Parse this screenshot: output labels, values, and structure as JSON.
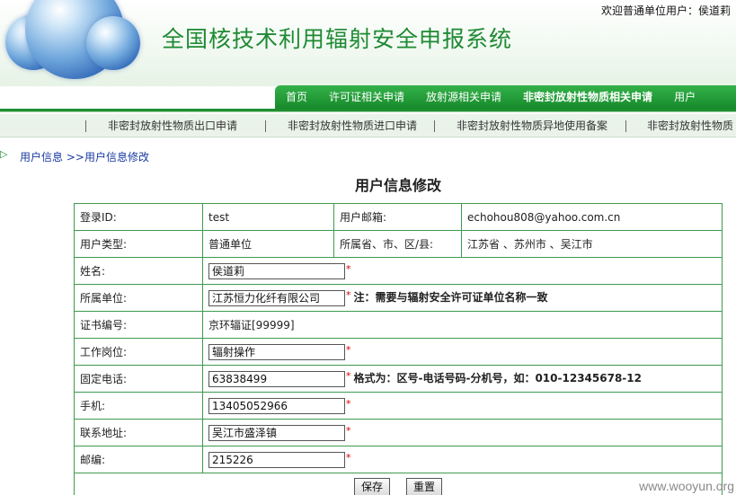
{
  "header": {
    "title": "全国核技术利用辐射安全申报系统",
    "welcome_prefix": "欢迎普通单位用户：",
    "welcome_user": "侯道莉"
  },
  "nav": {
    "items": [
      {
        "label": "首页"
      },
      {
        "label": "许可证相关申请"
      },
      {
        "label": "放射源相关申请"
      },
      {
        "label": "非密封放射性物质相关申请"
      },
      {
        "label": "用户"
      }
    ]
  },
  "subnav": {
    "items": [
      {
        "label": "非密封放射性物质出口申请"
      },
      {
        "label": "非密封放射性物质进口申请"
      },
      {
        "label": "非密封放射性物质异地使用备案"
      },
      {
        "label": "非密封放射性物质"
      }
    ]
  },
  "breadcrumb": {
    "home": "用户信息",
    "separator": ">>",
    "current": "用户信息修改"
  },
  "page_title": "用户信息修改",
  "form": {
    "login_id_label": "登录ID:",
    "login_id_value": "test",
    "email_label": "用户邮箱:",
    "email_value": "echohou808@yahoo.com.cn",
    "user_type_label": "用户类型:",
    "user_type_value": "普通单位",
    "region_label": "所属省、市、区/县:",
    "region_value": "江苏省 、苏州市 、吴江市",
    "name_label": "姓名:",
    "name_value": "侯道莉",
    "org_label": "所属单位:",
    "org_value": "江苏恒力化纤有限公司",
    "org_note": "注：需要与辐射安全许可证单位名称一致",
    "cert_label": "证书编号:",
    "cert_value": "京环辐证[99999]",
    "post_label": "工作岗位:",
    "post_value": "辐射操作",
    "phone_label": "固定电话:",
    "phone_value": "63838499",
    "phone_note": "格式为：区号-电话号码-分机号，如：010-12345678-12",
    "mobile_label": "手机:",
    "mobile_value": "13405052966",
    "address_label": "联系地址:",
    "address_value": "吴江市盛泽镇",
    "zip_label": "邮编:",
    "zip_value": "215226",
    "required_mark": "*"
  },
  "buttons": {
    "save": "保存",
    "reset": "重置"
  },
  "watermark": "www.wooyun.org",
  "colors": {
    "brand_green": "#1f8f32",
    "title_green": "#1e8a33",
    "required_red": "#d40000",
    "link_blue": "#1a3aa0"
  }
}
